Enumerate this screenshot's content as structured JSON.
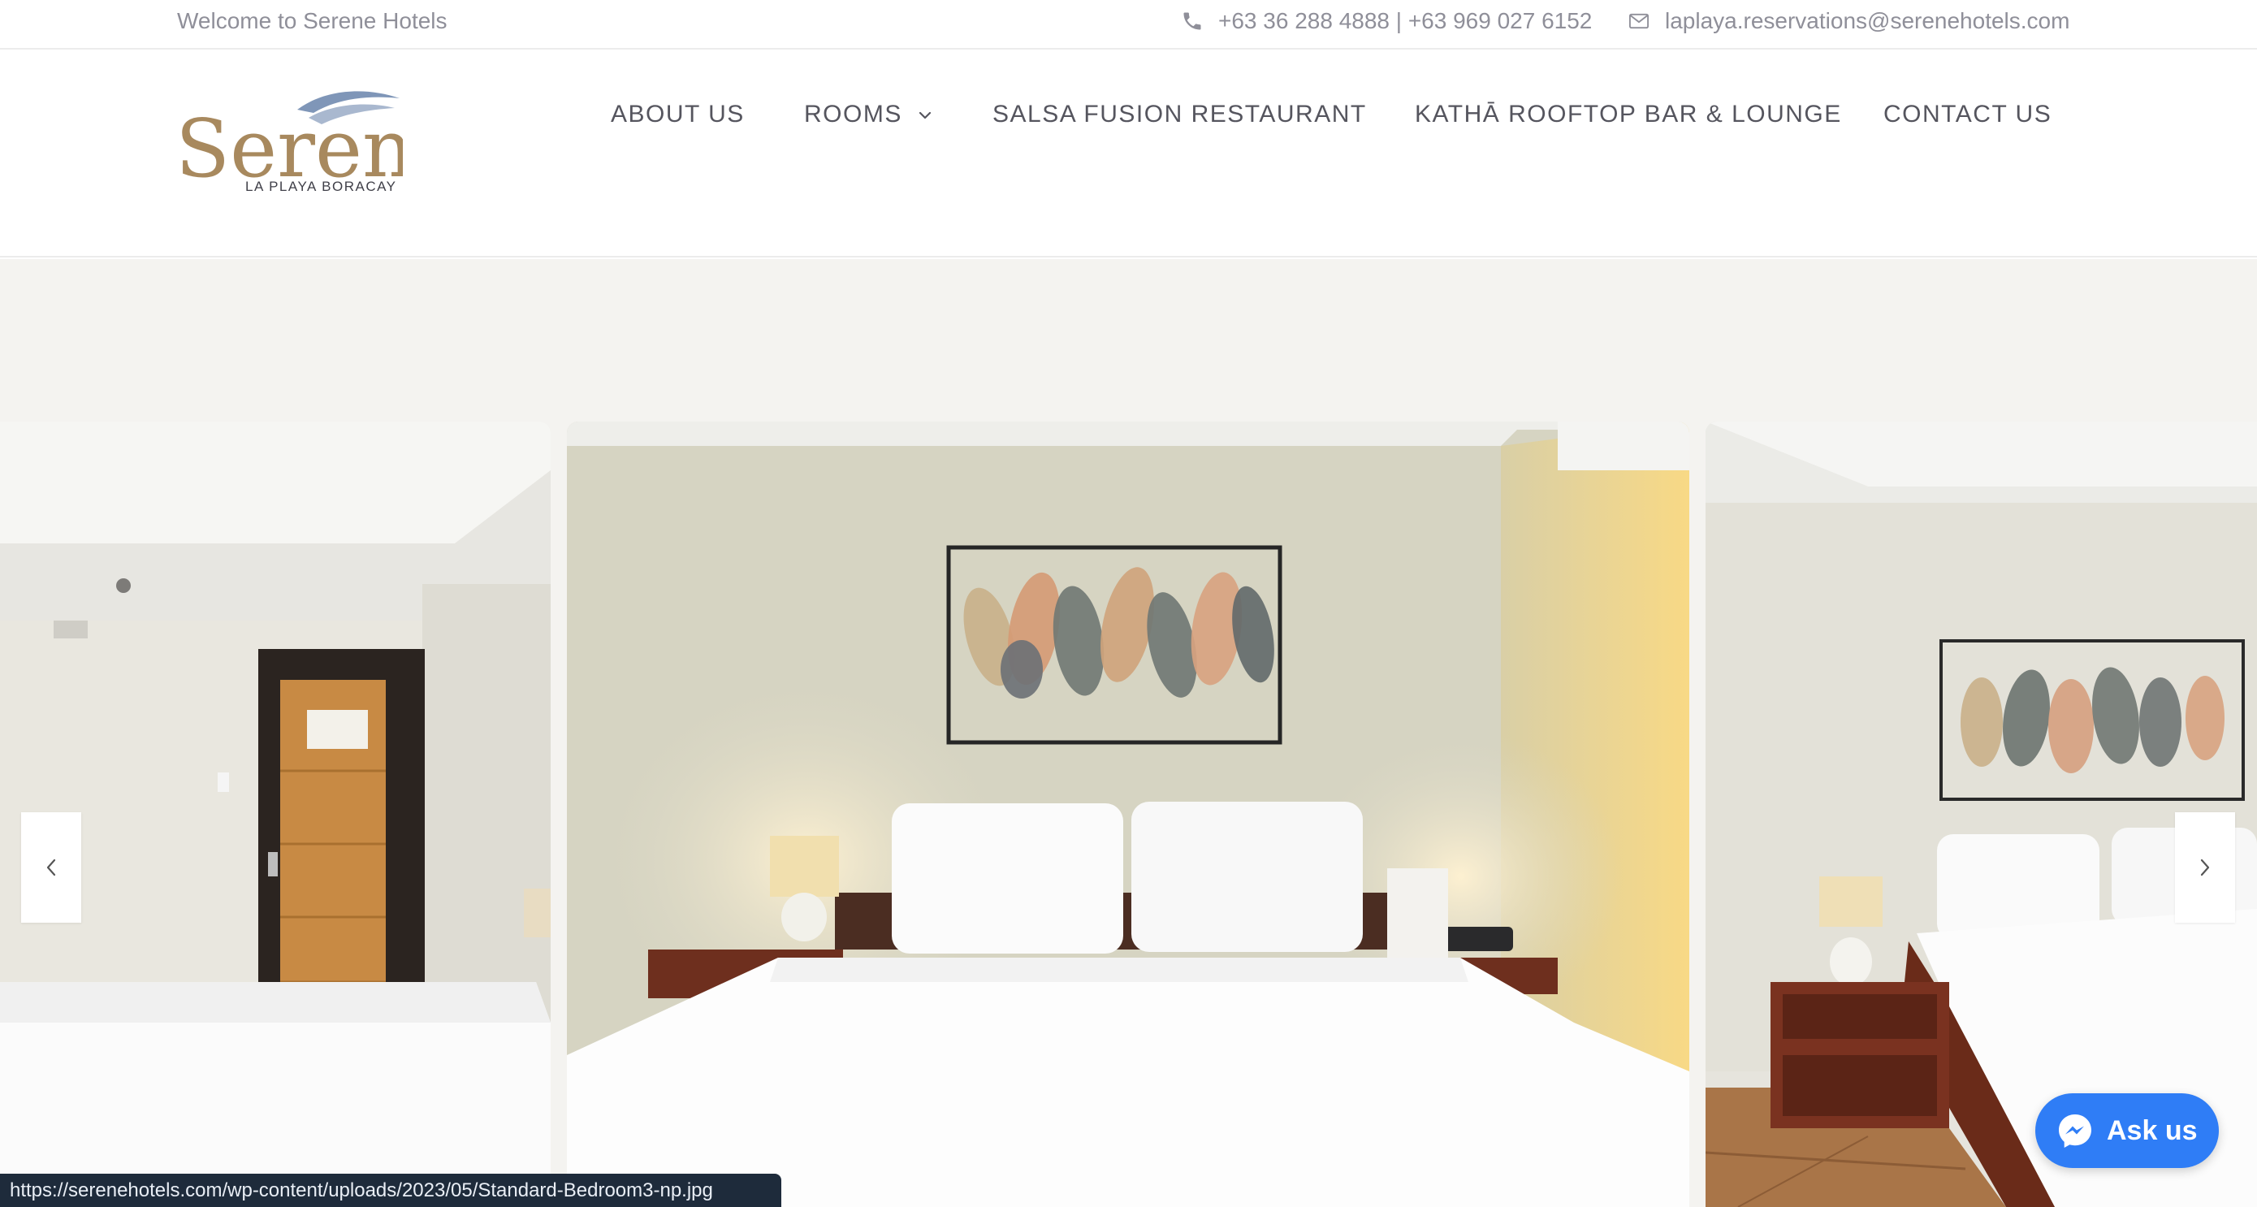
{
  "topbar": {
    "welcome": "Welcome to Serene Hotels",
    "phone": "+63 36 288 4888 | +63 969 027 6152",
    "email": "laplaya.reservations@serenehotels.com",
    "phone_icon": "phone-icon",
    "email_icon": "envelope-icon"
  },
  "logo": {
    "wordmark": "Serene",
    "tagline": "LA PLAYA BORACAY",
    "colors": {
      "gold": "#a8895e",
      "wave_blue": "#7f96b8",
      "text": "#3f3f48"
    }
  },
  "nav": {
    "items": [
      {
        "label": "ABOUT US"
      },
      {
        "label": "ROOMS",
        "has_dropdown": true
      },
      {
        "label": "SALSA FUSION RESTAURANT"
      },
      {
        "label": "KATHĀ ROOFTOP BAR & LOUNGE"
      },
      {
        "label": "CONTACT US"
      }
    ]
  },
  "gallery": {
    "prev_icon": "chevron-left-icon",
    "next_icon": "chevron-right-icon"
  },
  "chat": {
    "label": "Ask us",
    "icon": "messenger-icon",
    "color": "#2f7df6"
  },
  "status_bar": {
    "url": "https://serenehotels.com/wp-content/uploads/2023/05/Standard-Bedroom3-np.jpg"
  },
  "colors": {
    "band_bg": "#f4f3f0",
    "nav_text": "#55555e",
    "topbar_text": "#8f8f99"
  }
}
